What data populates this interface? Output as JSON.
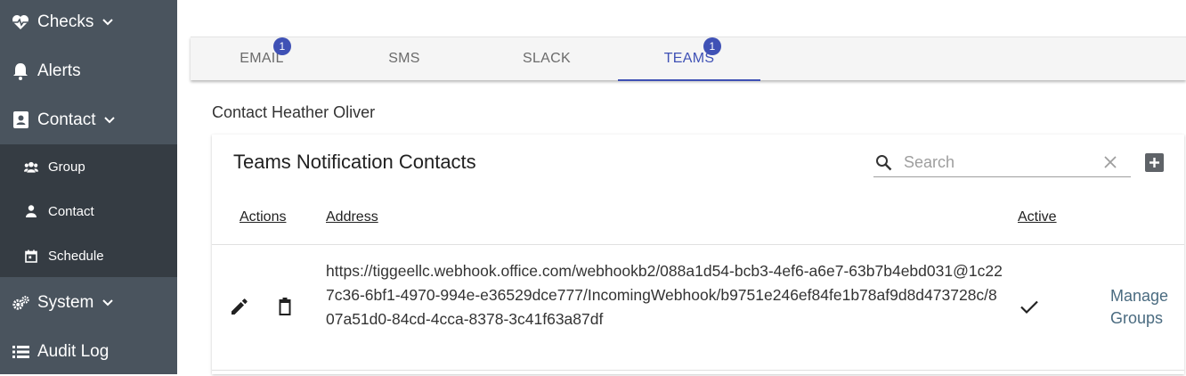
{
  "sidebar": {
    "items": [
      {
        "label": "Checks",
        "icon": "heartbeat-icon",
        "has_chevron": true
      },
      {
        "label": "Alerts",
        "icon": "bell-icon",
        "has_chevron": false
      },
      {
        "label": "Contact",
        "icon": "contact-book-icon",
        "has_chevron": true
      },
      {
        "label": "System",
        "icon": "gears-icon",
        "has_chevron": true
      },
      {
        "label": "Audit Log",
        "icon": "list-icon",
        "has_chevron": false
      }
    ],
    "submenu": [
      {
        "label": "Group",
        "icon": "users-icon"
      },
      {
        "label": "Contact",
        "icon": "user-icon"
      },
      {
        "label": "Schedule",
        "icon": "calendar-icon"
      }
    ]
  },
  "tabs": [
    {
      "label": "EMAIL",
      "badge": "1",
      "active": false
    },
    {
      "label": "SMS",
      "badge": "",
      "active": false
    },
    {
      "label": "SLACK",
      "badge": "",
      "active": false
    },
    {
      "label": "TEAMS",
      "badge": "1",
      "active": true
    }
  ],
  "contact_title": "Contact Heather Oliver",
  "card": {
    "title": "Teams Notification Contacts",
    "search_placeholder": "Search",
    "search_value": "",
    "columns": {
      "actions": "Actions",
      "address": "Address",
      "active": "Active"
    },
    "rows": [
      {
        "address": "https://tiggeellc.webhook.office.com/webhookb2/088a1d54-bcb3-4ef6-a6e7-63b7b4ebd031@1c227c36-6bf1-4970-994e-e36529dce777/IncomingWebhook/b9751e246ef84fe1b78af9d8d473728c/807a51d0-84cd-4cca-8378-3c41f63a87df",
        "active": true,
        "manage_line1": "Manage",
        "manage_line2": "Groups"
      }
    ]
  },
  "colors": {
    "sidebar_bg": "#4a545e",
    "submenu_bg": "#353c43",
    "accent": "#3f51b5",
    "link": "#4a6b80"
  }
}
